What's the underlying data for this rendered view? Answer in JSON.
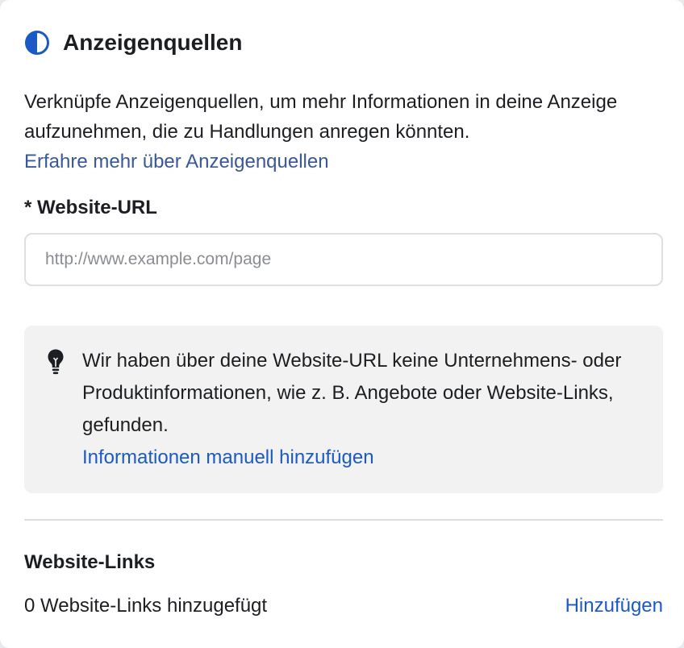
{
  "header": {
    "icon": "half-circle-icon",
    "title": "Anzeigenquellen"
  },
  "description": {
    "text": "Verknüpfe Anzeigenquellen, um mehr Informationen in deine Anzeige aufzunehmen, die zu Handlungen anregen könnten.",
    "learn_more_link": "Erfahre mehr über Anzeigenquellen"
  },
  "website_url": {
    "label": "* Website-URL",
    "value": "",
    "placeholder": "http://www.example.com/page"
  },
  "info": {
    "icon": "lightbulb-icon",
    "text": "Wir haben über deine Website-URL keine Unternehmens- oder Produktinformationen, wie z. B. Angebote oder Website-Links, gefunden.",
    "action_link": "Informationen manuell hinzufügen"
  },
  "website_links": {
    "title": "Website-Links",
    "count_text": "0 Website-Links hinzugefügt",
    "add_label": "Hinzufügen"
  },
  "colors": {
    "accent_blue": "#1b59c6",
    "link_blue": "#385898",
    "info_background": "#f2f2f2"
  }
}
